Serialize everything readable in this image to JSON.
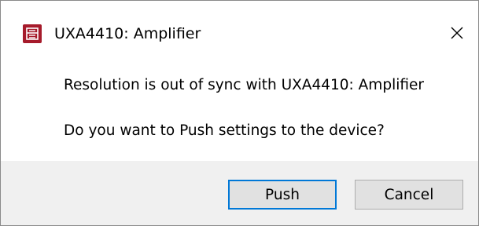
{
  "window": {
    "title": "UXA4410: Amplifier",
    "app_icon": "app-logo-icon",
    "close_icon": "close-icon"
  },
  "message": {
    "line1": "Resolution is out of sync with UXA4410: Amplifier",
    "line2": "Do you want to Push settings to the device?"
  },
  "buttons": {
    "push_label": "Push",
    "cancel_label": "Cancel"
  },
  "colors": {
    "app_icon": "#a61b2b",
    "default_button_border": "#0078d7",
    "footer_bg": "#f0f0f0"
  }
}
